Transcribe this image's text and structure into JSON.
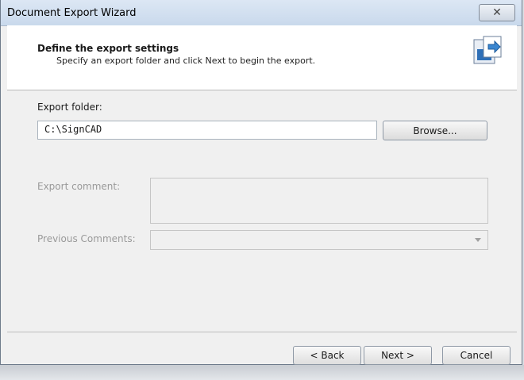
{
  "window": {
    "title": "Document Export Wizard",
    "close_icon": "✕"
  },
  "header": {
    "title": "Define the export settings",
    "subtitle": "Specify an export folder and click Next to begin the export.",
    "icon": "export-document-icon"
  },
  "form": {
    "export_folder_label": "Export folder:",
    "export_folder_value": "C:\\SignCAD",
    "browse_label": "Browse...",
    "export_comment_label": "Export comment:",
    "export_comment_value": "",
    "previous_comments_label": "Previous Comments:",
    "previous_comments_value": ""
  },
  "buttons": {
    "back": "< Back",
    "next": "Next >",
    "cancel": "Cancel"
  }
}
